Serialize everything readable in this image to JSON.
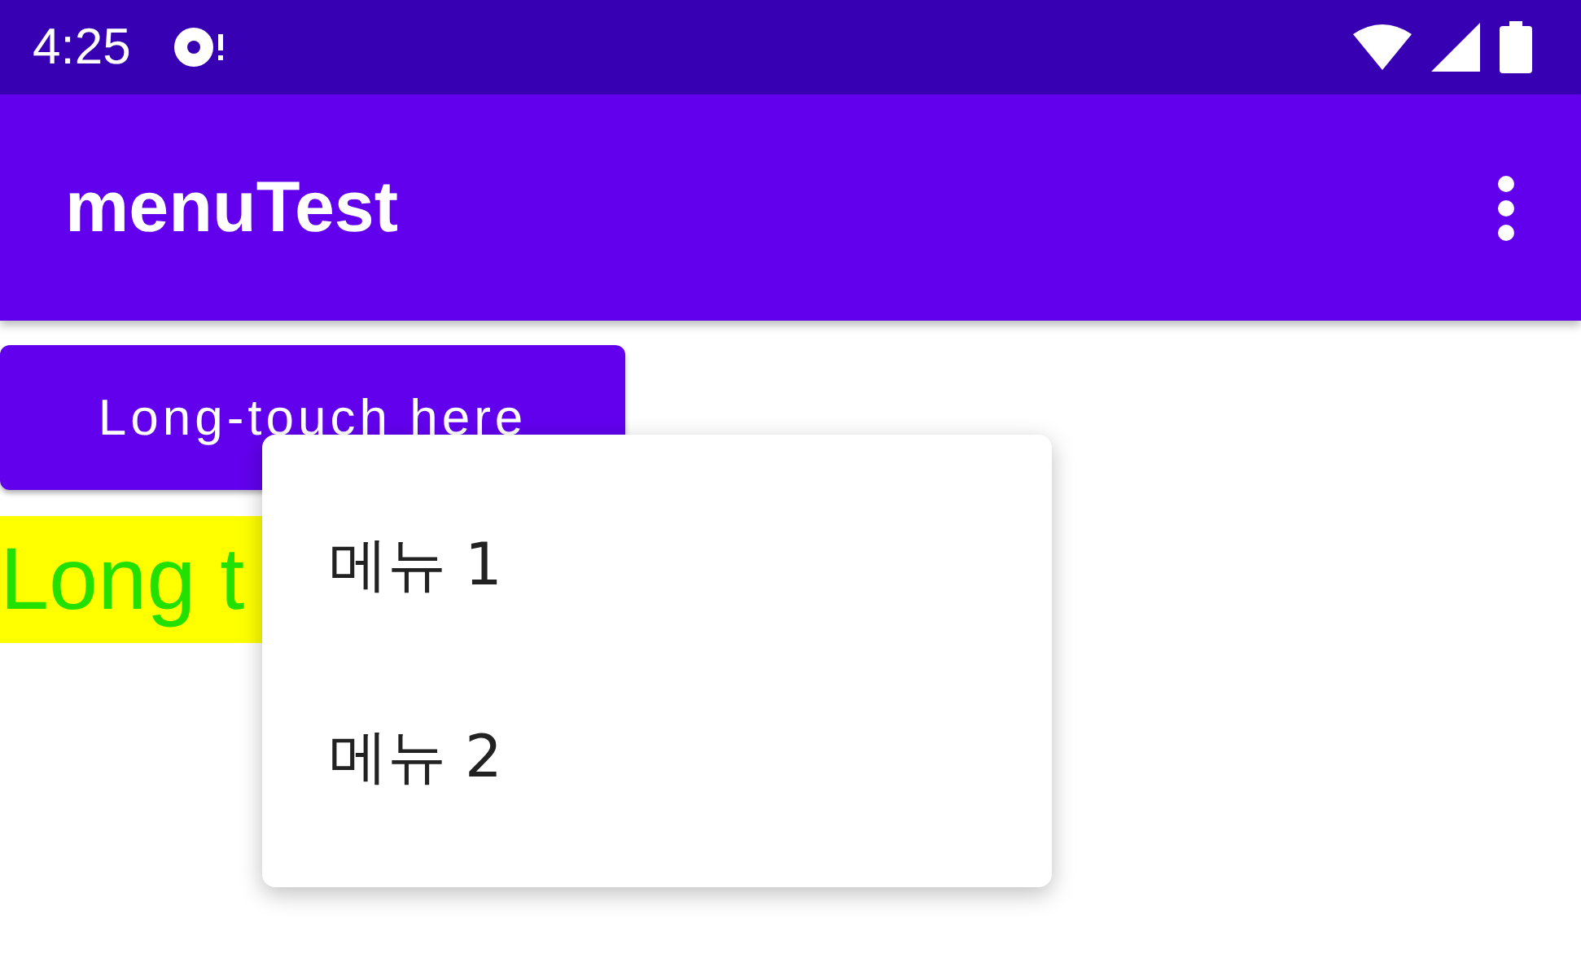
{
  "status_bar": {
    "time": "4:25"
  },
  "app_bar": {
    "title": "menuTest"
  },
  "button": {
    "label": "Long-touch here"
  },
  "highlight_text": "Long t",
  "context_menu": {
    "items": [
      {
        "label": "메뉴 1"
      },
      {
        "label": "메뉴 2"
      }
    ]
  }
}
